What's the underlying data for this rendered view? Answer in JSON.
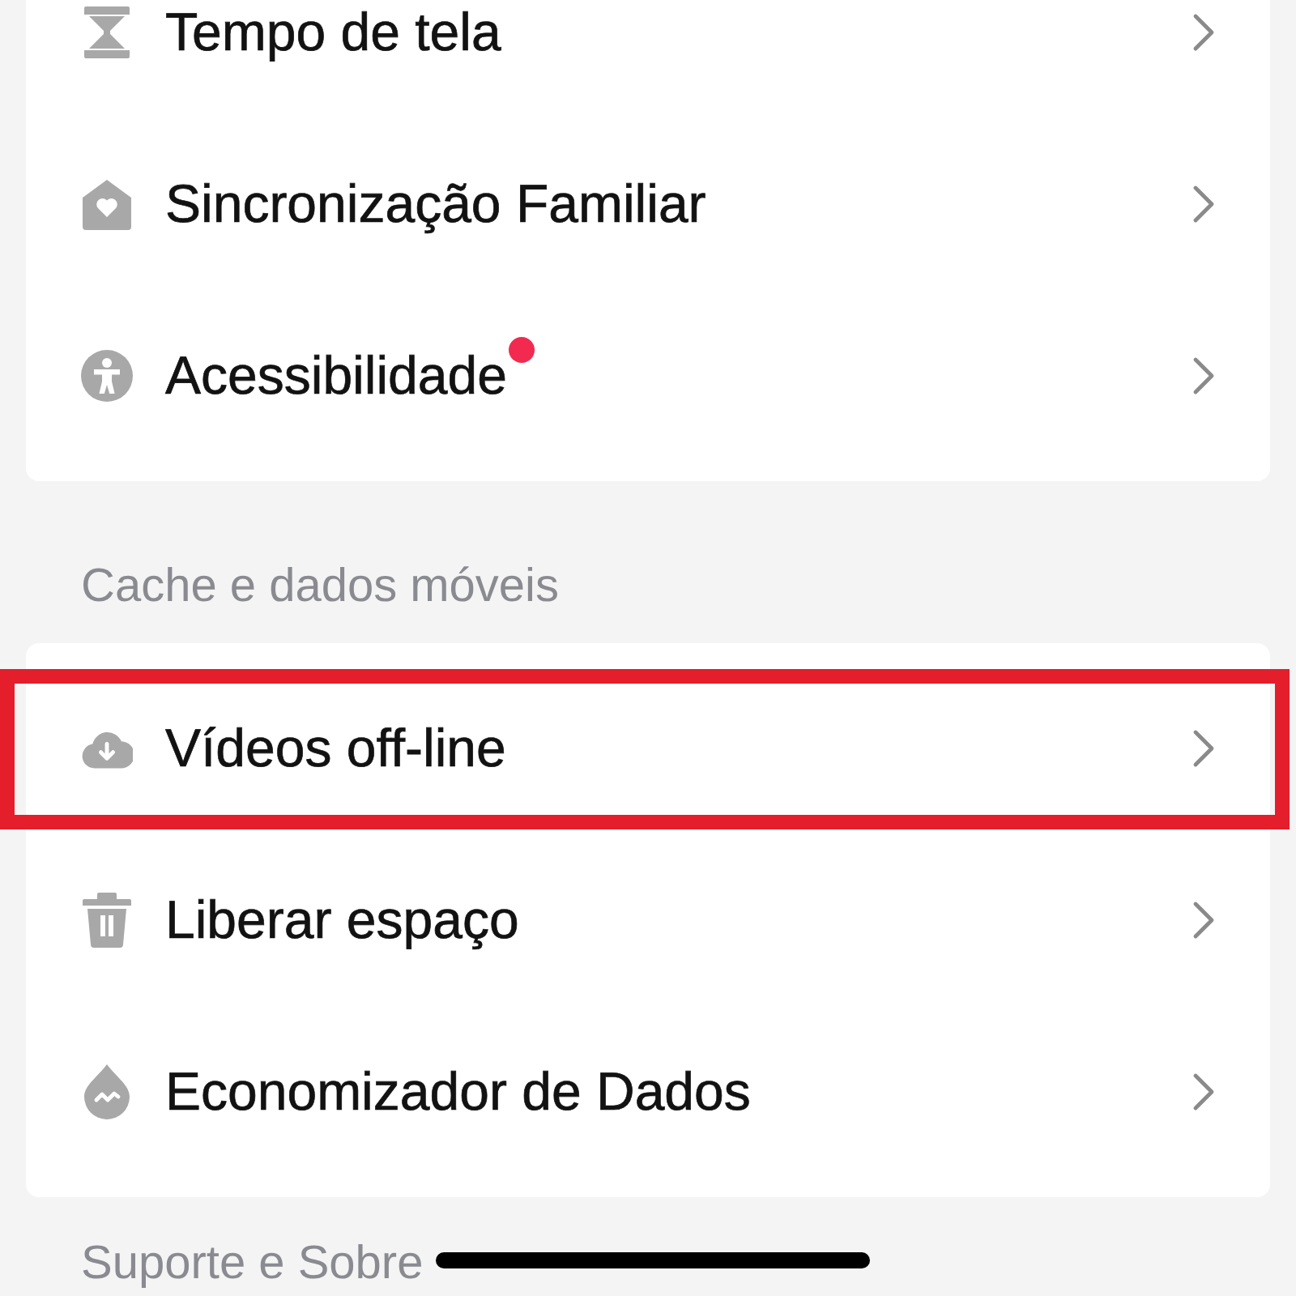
{
  "sections": [
    {
      "items": [
        {
          "label": "Tempo de tela",
          "new_badge": false,
          "highlighted": false
        },
        {
          "label": "Sincronização Familiar",
          "new_badge": false,
          "highlighted": false
        },
        {
          "label": "Acessibilidade",
          "new_badge": true,
          "highlighted": false
        }
      ]
    },
    {
      "title": "Cache e dados móveis",
      "items": [
        {
          "label": "Vídeos off-line",
          "new_badge": false,
          "highlighted": true
        },
        {
          "label": "Liberar espaço",
          "new_badge": false,
          "highlighted": false
        },
        {
          "label": "Economizador de Dados",
          "new_badge": false,
          "highlighted": false
        }
      ]
    },
    {
      "title": "Suporte e Sobre"
    }
  ]
}
